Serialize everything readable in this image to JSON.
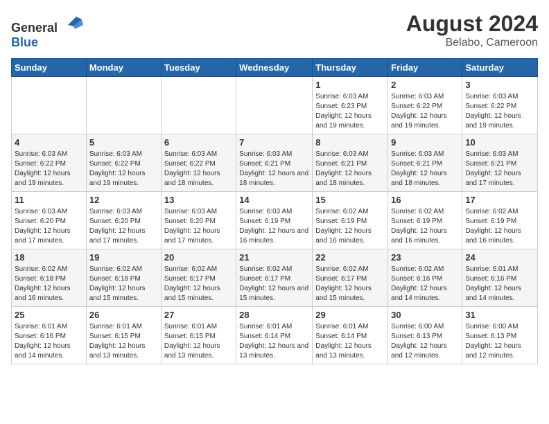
{
  "header": {
    "logo_general": "General",
    "logo_blue": "Blue",
    "month_year": "August 2024",
    "location": "Belabo, Cameroon"
  },
  "days_of_week": [
    "Sunday",
    "Monday",
    "Tuesday",
    "Wednesday",
    "Thursday",
    "Friday",
    "Saturday"
  ],
  "weeks": [
    [
      {
        "day": "",
        "info": ""
      },
      {
        "day": "",
        "info": ""
      },
      {
        "day": "",
        "info": ""
      },
      {
        "day": "",
        "info": ""
      },
      {
        "day": "1",
        "info": "Sunrise: 6:03 AM\nSunset: 6:23 PM\nDaylight: 12 hours and 19 minutes."
      },
      {
        "day": "2",
        "info": "Sunrise: 6:03 AM\nSunset: 6:22 PM\nDaylight: 12 hours and 19 minutes."
      },
      {
        "day": "3",
        "info": "Sunrise: 6:03 AM\nSunset: 6:22 PM\nDaylight: 12 hours and 19 minutes."
      }
    ],
    [
      {
        "day": "4",
        "info": "Sunrise: 6:03 AM\nSunset: 6:22 PM\nDaylight: 12 hours and 19 minutes."
      },
      {
        "day": "5",
        "info": "Sunrise: 6:03 AM\nSunset: 6:22 PM\nDaylight: 12 hours and 19 minutes."
      },
      {
        "day": "6",
        "info": "Sunrise: 6:03 AM\nSunset: 6:22 PM\nDaylight: 12 hours and 18 minutes."
      },
      {
        "day": "7",
        "info": "Sunrise: 6:03 AM\nSunset: 6:21 PM\nDaylight: 12 hours and 18 minutes."
      },
      {
        "day": "8",
        "info": "Sunrise: 6:03 AM\nSunset: 6:21 PM\nDaylight: 12 hours and 18 minutes."
      },
      {
        "day": "9",
        "info": "Sunrise: 6:03 AM\nSunset: 6:21 PM\nDaylight: 12 hours and 18 minutes."
      },
      {
        "day": "10",
        "info": "Sunrise: 6:03 AM\nSunset: 6:21 PM\nDaylight: 12 hours and 17 minutes."
      }
    ],
    [
      {
        "day": "11",
        "info": "Sunrise: 6:03 AM\nSunset: 6:20 PM\nDaylight: 12 hours and 17 minutes."
      },
      {
        "day": "12",
        "info": "Sunrise: 6:03 AM\nSunset: 6:20 PM\nDaylight: 12 hours and 17 minutes."
      },
      {
        "day": "13",
        "info": "Sunrise: 6:03 AM\nSunset: 6:20 PM\nDaylight: 12 hours and 17 minutes."
      },
      {
        "day": "14",
        "info": "Sunrise: 6:03 AM\nSunset: 6:19 PM\nDaylight: 12 hours and 16 minutes."
      },
      {
        "day": "15",
        "info": "Sunrise: 6:02 AM\nSunset: 6:19 PM\nDaylight: 12 hours and 16 minutes."
      },
      {
        "day": "16",
        "info": "Sunrise: 6:02 AM\nSunset: 6:19 PM\nDaylight: 12 hours and 16 minutes."
      },
      {
        "day": "17",
        "info": "Sunrise: 6:02 AM\nSunset: 6:19 PM\nDaylight: 12 hours and 16 minutes."
      }
    ],
    [
      {
        "day": "18",
        "info": "Sunrise: 6:02 AM\nSunset: 6:18 PM\nDaylight: 12 hours and 16 minutes."
      },
      {
        "day": "19",
        "info": "Sunrise: 6:02 AM\nSunset: 6:18 PM\nDaylight: 12 hours and 15 minutes."
      },
      {
        "day": "20",
        "info": "Sunrise: 6:02 AM\nSunset: 6:17 PM\nDaylight: 12 hours and 15 minutes."
      },
      {
        "day": "21",
        "info": "Sunrise: 6:02 AM\nSunset: 6:17 PM\nDaylight: 12 hours and 15 minutes."
      },
      {
        "day": "22",
        "info": "Sunrise: 6:02 AM\nSunset: 6:17 PM\nDaylight: 12 hours and 15 minutes."
      },
      {
        "day": "23",
        "info": "Sunrise: 6:02 AM\nSunset: 6:16 PM\nDaylight: 12 hours and 14 minutes."
      },
      {
        "day": "24",
        "info": "Sunrise: 6:01 AM\nSunset: 6:16 PM\nDaylight: 12 hours and 14 minutes."
      }
    ],
    [
      {
        "day": "25",
        "info": "Sunrise: 6:01 AM\nSunset: 6:16 PM\nDaylight: 12 hours and 14 minutes."
      },
      {
        "day": "26",
        "info": "Sunrise: 6:01 AM\nSunset: 6:15 PM\nDaylight: 12 hours and 13 minutes."
      },
      {
        "day": "27",
        "info": "Sunrise: 6:01 AM\nSunset: 6:15 PM\nDaylight: 12 hours and 13 minutes."
      },
      {
        "day": "28",
        "info": "Sunrise: 6:01 AM\nSunset: 6:14 PM\nDaylight: 12 hours and 13 minutes."
      },
      {
        "day": "29",
        "info": "Sunrise: 6:01 AM\nSunset: 6:14 PM\nDaylight: 12 hours and 13 minutes."
      },
      {
        "day": "30",
        "info": "Sunrise: 6:00 AM\nSunset: 6:13 PM\nDaylight: 12 hours and 12 minutes."
      },
      {
        "day": "31",
        "info": "Sunrise: 6:00 AM\nSunset: 6:13 PM\nDaylight: 12 hours and 12 minutes."
      }
    ]
  ]
}
